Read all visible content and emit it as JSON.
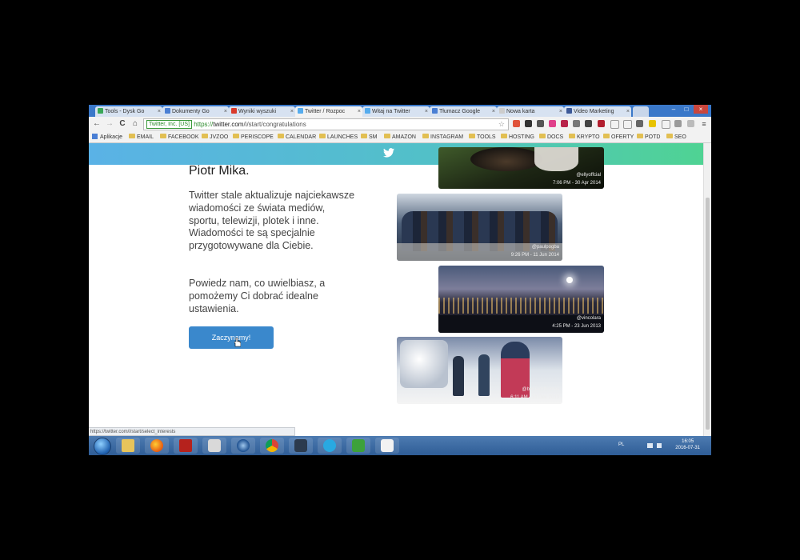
{
  "browser": {
    "tabs": [
      {
        "title": "Tools - Dysk Go",
        "color": "#3aa757"
      },
      {
        "title": "Dokumenty Go",
        "color": "#4a7fd4"
      },
      {
        "title": "Wyniki wyszuki",
        "color": "#d93a2b"
      },
      {
        "title": "Twitter / Rozpoc",
        "color": "#55acee"
      },
      {
        "title": "Witaj na Twitter",
        "color": "#55acee"
      },
      {
        "title": "Tłumacz Google",
        "color": "#4a7fd4"
      },
      {
        "title": "Nowa karta",
        "color": "#cccccc"
      },
      {
        "title": "Video Marketing",
        "color": "#3b5998"
      }
    ],
    "tab_close": "×",
    "window_controls": {
      "minimize": "–",
      "maximize": "□",
      "close": "×"
    },
    "nav": {
      "back": "←",
      "forward": "→",
      "reload": "C",
      "home": "⌂"
    },
    "address": {
      "secure_label": "Twitter, Inc. [US]",
      "url_scheme": "https://",
      "url_host": "twitter.com",
      "url_path": "/i/start/congratulations",
      "star": "☆"
    },
    "bookmarks": [
      {
        "label": "Aplikacje",
        "kind": "apps"
      },
      {
        "label": "EMAIL",
        "kind": "folder"
      },
      {
        "label": "FACEBOOK",
        "kind": "folder"
      },
      {
        "label": "JVZOO",
        "kind": "folder"
      },
      {
        "label": "PERISCOPE",
        "kind": "folder"
      },
      {
        "label": "CALENDAR",
        "kind": "folder"
      },
      {
        "label": "LAUNCHES",
        "kind": "folder"
      },
      {
        "label": "SM",
        "kind": "folder"
      },
      {
        "label": "AMAZON",
        "kind": "folder"
      },
      {
        "label": "INSTAGRAM",
        "kind": "folder"
      },
      {
        "label": "TOOLS",
        "kind": "folder"
      },
      {
        "label": "HOSTING",
        "kind": "folder"
      },
      {
        "label": "DOCS",
        "kind": "folder"
      },
      {
        "label": "KRYPTO",
        "kind": "folder"
      },
      {
        "label": "OFERTY",
        "kind": "folder"
      },
      {
        "label": "POTD",
        "kind": "folder"
      },
      {
        "label": "SEO",
        "kind": "folder"
      }
    ],
    "status_url": "https://twitter.com/i/start/select_interests"
  },
  "page": {
    "name": "Piotr Mika.",
    "paragraph1": "Twitter stale aktualizuje najciekawsze wiadomości ze świata mediów, sportu, telewizji, plotek i inne. Wiadomości te są specjalnie przygotowywane dla Ciebie.",
    "paragraph2": "Powiedz nam, co uwielbiasz, a pomożemy Ci dobrać idealne ustawienia.",
    "start_button": "Zaczynamy!",
    "photos": [
      {
        "handle": "@ellyoffcial",
        "when": "7:06 PM - 30 Apr 2014"
      },
      {
        "handle": "@paulpogba",
        "when": "9:26 PM - 11 Jun 2014"
      },
      {
        "handle": "@vincolara",
        "when": "4:25 PM - 23 Jun 2013"
      },
      {
        "handle": "@benjackthomas",
        "when": "6:11 AM - 31 Dec 2013"
      }
    ]
  },
  "taskbar": {
    "language": "PL",
    "time": "16:05",
    "date": "2016-07-31"
  }
}
